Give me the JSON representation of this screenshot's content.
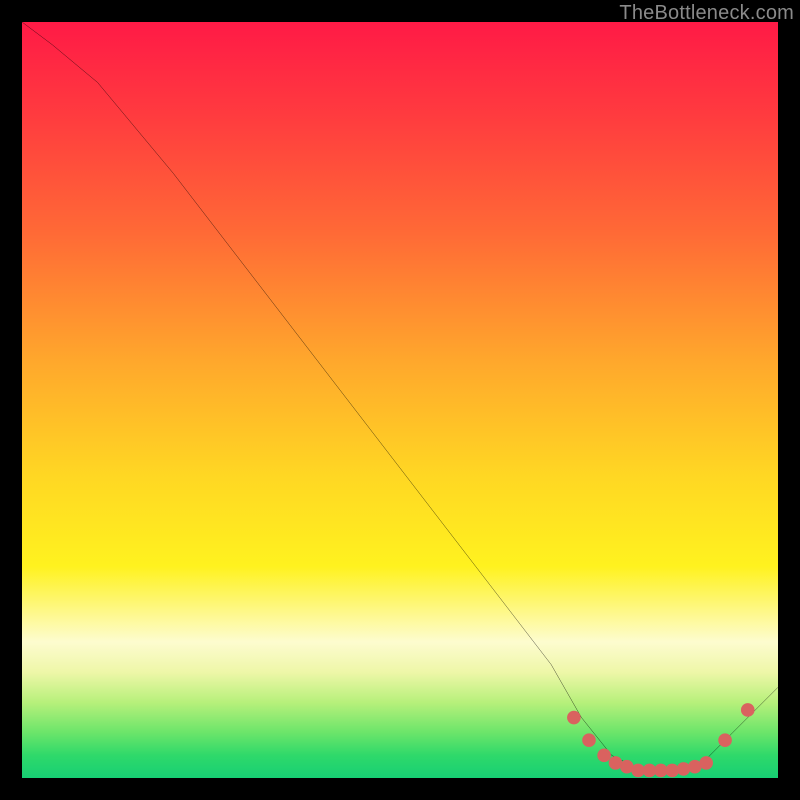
{
  "watermark": "TheBottleneck.com",
  "colors": {
    "background": "#000000",
    "curve": "#000000",
    "marker": "#d9625f",
    "gradient_top": "#ff1a46",
    "gradient_mid": "#ffd723",
    "gradient_bottom": "#17cf74"
  },
  "chart_data": {
    "type": "line",
    "title": "",
    "xlabel": "",
    "ylabel": "",
    "xlim": [
      0,
      100
    ],
    "ylim": [
      0,
      100
    ],
    "grid": false,
    "legend": false,
    "series": [
      {
        "name": "bottleneck-curve",
        "x": [
          0,
          4,
          10,
          20,
          30,
          40,
          50,
          60,
          70,
          74,
          78,
          82,
          86,
          90,
          94,
          100
        ],
        "y": [
          100,
          97,
          92,
          80,
          67,
          54,
          41,
          28,
          15,
          8,
          3,
          1,
          1,
          2,
          6,
          12
        ]
      }
    ],
    "markers": {
      "name": "optimal-range-dots",
      "x": [
        73,
        75,
        77,
        78.5,
        80,
        81.5,
        83,
        84.5,
        86,
        87.5,
        89,
        90.5,
        93,
        96
      ],
      "y": [
        8,
        5,
        3,
        2,
        1.5,
        1,
        1,
        1,
        1,
        1.2,
        1.5,
        2,
        5,
        9
      ]
    }
  }
}
